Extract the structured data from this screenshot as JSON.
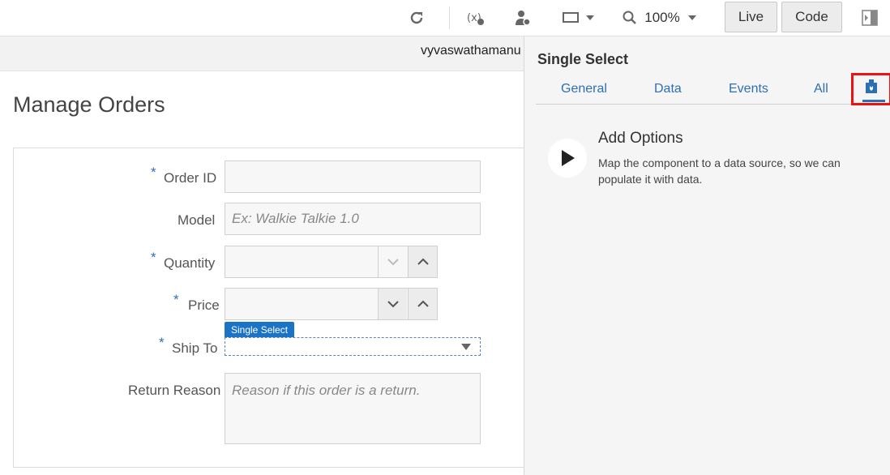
{
  "toolbar": {
    "zoom_value": "100%",
    "live_label": "Live",
    "code_label": "Code"
  },
  "user": {
    "name": "vyvaswathamanu"
  },
  "canvas": {
    "title": "Manage Orders",
    "form": {
      "order_id_label": "Order ID",
      "model_label": "Model",
      "model_placeholder": "Ex: Walkie Talkie 1.0",
      "quantity_label": "Quantity",
      "price_label": "Price",
      "ship_to_label": "Ship To",
      "selected_badge": "Single Select",
      "return_reason_label": "Return Reason",
      "return_reason_placeholder": "Reason if this order is a return.",
      "required_marker": "*"
    }
  },
  "panel": {
    "title": "Single Select",
    "tabs": [
      "General",
      "Data",
      "Events",
      "All"
    ],
    "active_tab_icon": "quick-start-icon",
    "add_options": {
      "title": "Add Options",
      "description": "Map the component to a data source, so we can populate it with data."
    }
  },
  "colors": {
    "accent": "#2d6fb3",
    "badge": "#1a73c7",
    "highlight": "#e11111"
  }
}
